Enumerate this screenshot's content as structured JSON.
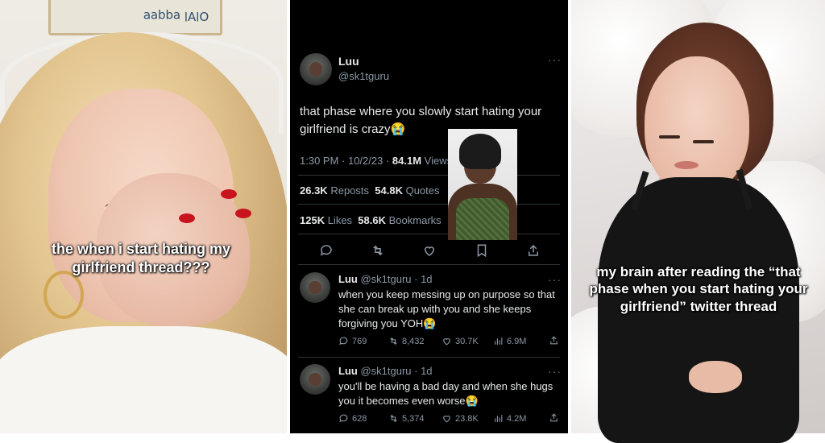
{
  "panels": [
    {
      "caption": "the when i start hating my girlfriend thread???",
      "sign_text": "Ol∀l ɐqqɐɐ"
    },
    {
      "tweet": {
        "name": "Luu",
        "handle": "@sk1tguru",
        "text": "that phase where you slowly start hating your girlfriend is crazy",
        "emoji": "😭",
        "time": "1:30 PM · 10/2/23 ·",
        "views_count": "84.1M",
        "views_label": "Views",
        "reposts_count": "26.3K",
        "reposts_label": "Reposts",
        "quotes_count": "54.8K",
        "quotes_label": "Quotes",
        "likes_count": "125K",
        "likes_label": "Likes",
        "bookmarks_count": "58.6K",
        "bookmarks_label": "Bookmarks"
      },
      "replies": [
        {
          "name": "Luu",
          "handle": "@sk1tguru · 1d",
          "text": "when you keep messing up on purpose so that she can break up with you and she keeps forgiving you YOH",
          "emoji": "😭",
          "replies": "769",
          "reposts": "8,432",
          "likes": "30.7K",
          "views": "6.9M"
        },
        {
          "name": "Luu",
          "handle": "@sk1tguru · 1d",
          "text": "you'll be having a bad day and when she hugs you it becomes even worse",
          "emoji": "😭",
          "replies": "628",
          "reposts": "5,374",
          "likes": "23.8K",
          "views": "4.2M"
        }
      ],
      "more_icon": "···"
    },
    {
      "caption": "my brain after reading the “that phase when you start hating your girlfriend” twitter thread"
    }
  ],
  "icons": {
    "reply": "comment-icon",
    "repost": "repost-icon",
    "like": "heart-icon",
    "bookmark": "bookmark-icon",
    "share": "share-icon",
    "views": "bar-chart-icon"
  },
  "colors": {
    "tweet_bg": "#000000",
    "tweet_text": "#e7e9ea",
    "muted_text": "#8b98a5",
    "divider": "#2f3336",
    "caption_text": "#ffffff"
  }
}
